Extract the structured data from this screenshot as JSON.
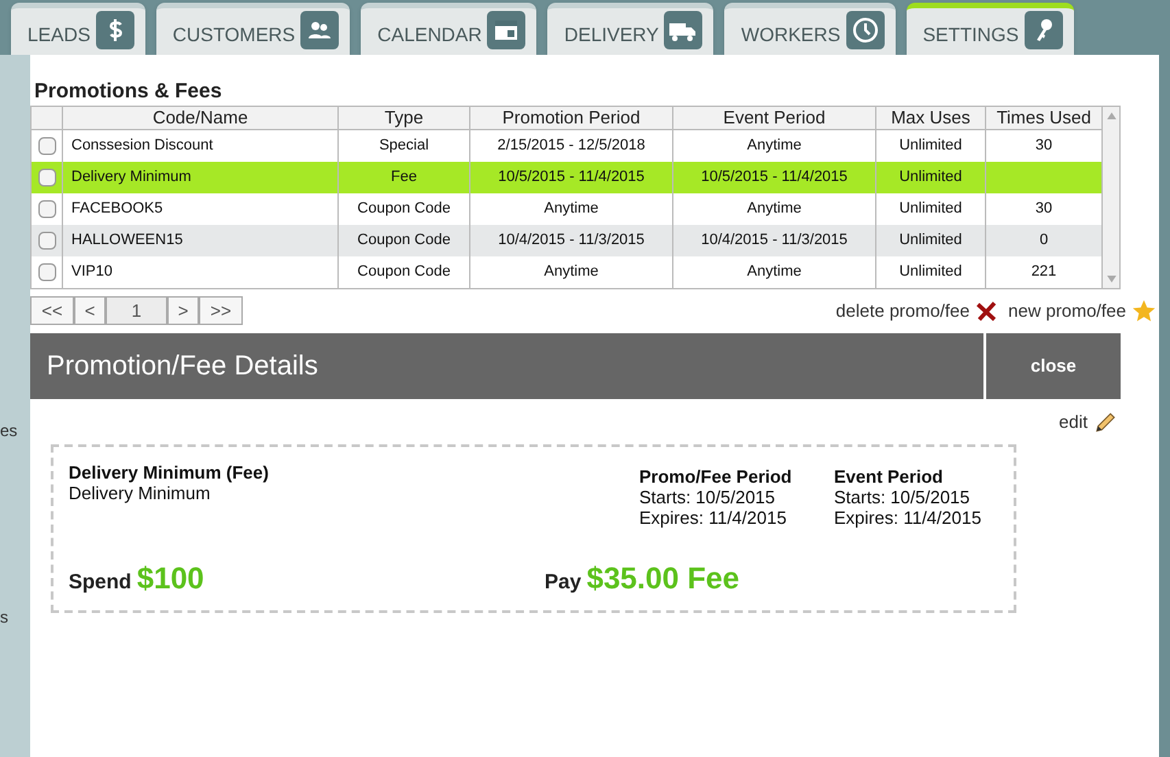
{
  "tabs": [
    {
      "label": "LEADS",
      "selected": false
    },
    {
      "label": "CUSTOMERS",
      "selected": false
    },
    {
      "label": "CALENDAR",
      "selected": false
    },
    {
      "label": "DELIVERY",
      "selected": false
    },
    {
      "label": "WORKERS",
      "selected": false
    },
    {
      "label": "SETTINGS",
      "selected": true
    }
  ],
  "sidebar": {
    "items": [
      "es",
      "s"
    ]
  },
  "promotions": {
    "title": "Promotions & Fees",
    "columns": [
      "Code/Name",
      "Type",
      "Promotion Period",
      "Event Period",
      "Max Uses",
      "Times Used"
    ],
    "rows": [
      {
        "cells": [
          "Conssesion Discount",
          "Special",
          "2/15/2015 - 12/5/2018",
          "Anytime",
          "Unlimited",
          "30"
        ],
        "checked": false,
        "selected": false,
        "hovered": false
      },
      {
        "cells": [
          "Delivery Minimum",
          "Fee",
          "10/5/2015 - 11/4/2015",
          "10/5/2015 - 11/4/2015",
          "Unlimited",
          ""
        ],
        "checked": false,
        "selected": true,
        "hovered": false
      },
      {
        "cells": [
          "FACEBOOK5",
          "Coupon Code",
          "Anytime",
          "Anytime",
          "Unlimited",
          "30"
        ],
        "checked": false,
        "selected": false,
        "hovered": false
      },
      {
        "cells": [
          "HALLOWEEN15",
          "Coupon Code",
          "10/4/2015 - 11/3/2015",
          "10/4/2015 - 11/3/2015",
          "Unlimited",
          "0"
        ],
        "checked": false,
        "selected": false,
        "hovered": true
      },
      {
        "cells": [
          "VIP10",
          "Coupon Code",
          "Anytime",
          "Anytime",
          "Unlimited",
          "221"
        ],
        "checked": false,
        "selected": false,
        "hovered": false
      }
    ],
    "pager": {
      "first": "<<",
      "prev": "<",
      "page": "1",
      "next": ">",
      "last": ">>"
    },
    "delete": "delete promo/fee",
    "new": "new promo/fee"
  },
  "details": {
    "title": "Promotion/Fee Details",
    "close": "close",
    "edit": "edit",
    "name": "Delivery Minimum (Fee)",
    "subtitle": "Delivery Minimum",
    "periods": [
      {
        "heading": "Promo/Fee Period",
        "starts": "Starts: 10/5/2015",
        "expires": "Expires: 11/4/2015"
      },
      {
        "heading": "Event Period",
        "starts": "Starts: 10/5/2015",
        "expires": "Expires: 11/4/2015"
      }
    ],
    "spend_label": "Spend",
    "spend": "$100",
    "pay_label": "Pay",
    "pay": "$35.00 Fee"
  }
}
